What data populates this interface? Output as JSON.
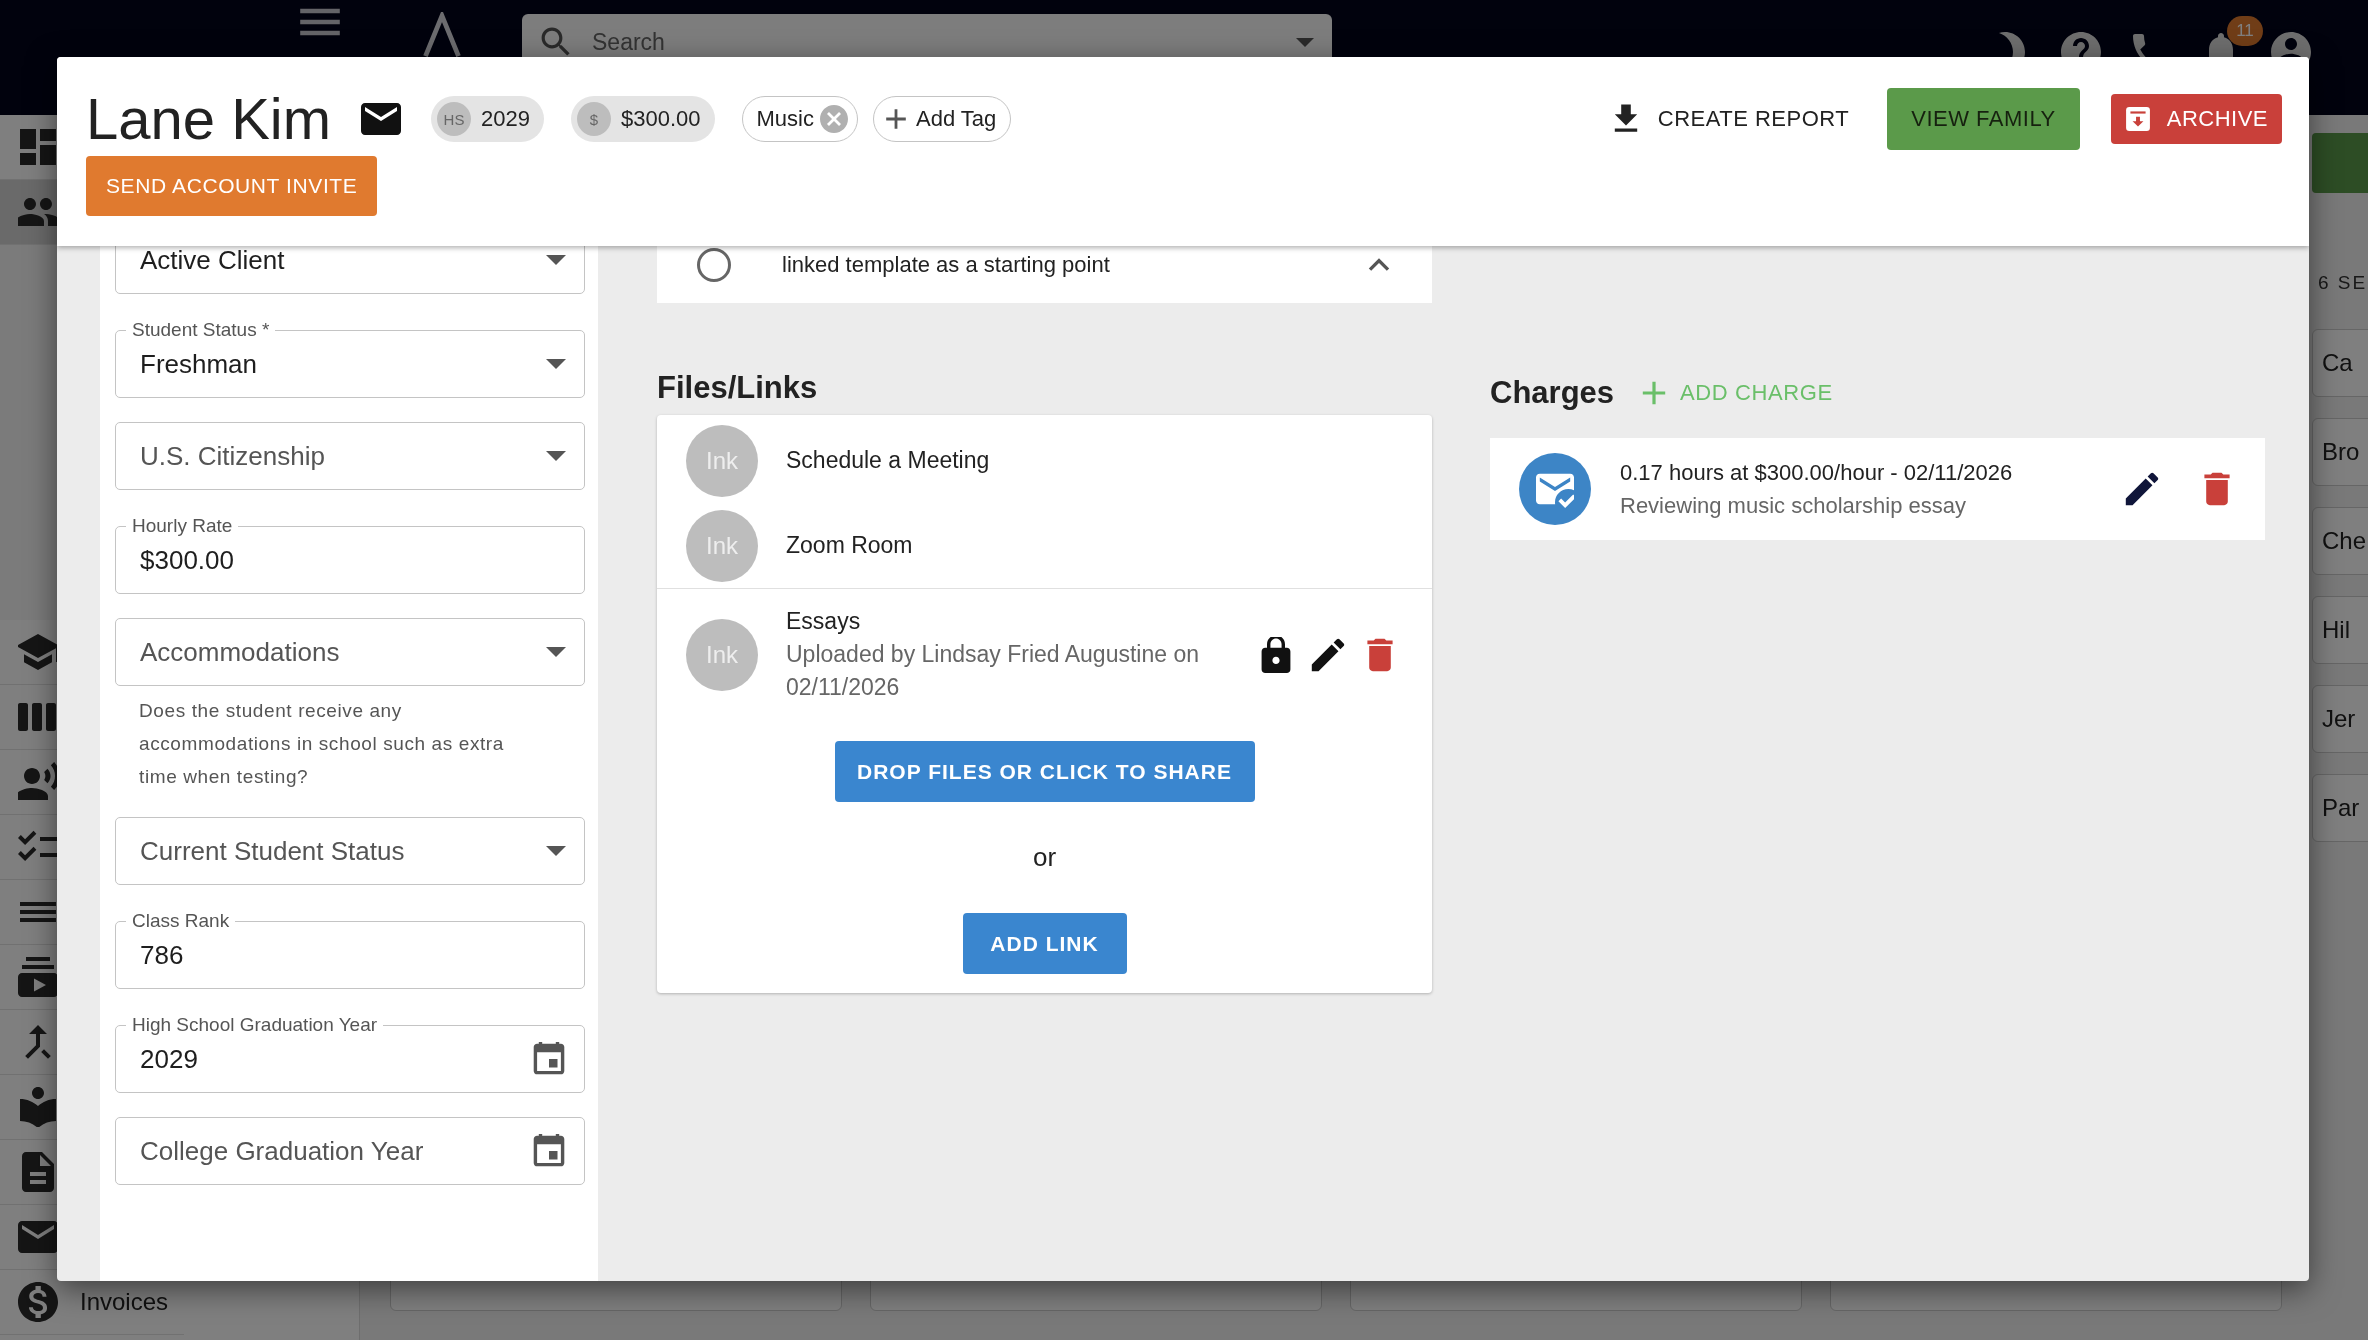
{
  "app": {
    "top_bar": {
      "search": {
        "placeholder": "Search"
      },
      "notification_count": "11"
    },
    "sidebar": {
      "top_items": [
        {
          "kind": "dashboard",
          "selected": false
        },
        {
          "kind": "people",
          "selected": true
        }
      ],
      "items": [
        {
          "kind": "school",
          "selected": false
        },
        {
          "kind": "columns",
          "selected": false
        },
        {
          "kind": "voice",
          "selected": false
        },
        {
          "kind": "checklist",
          "selected": false
        },
        {
          "kind": "list",
          "selected": false
        },
        {
          "kind": "video",
          "selected": false
        },
        {
          "kind": "merge",
          "selected": false
        },
        {
          "kind": "reader",
          "selected": false
        },
        {
          "kind": "document",
          "selected": false
        },
        {
          "kind": "mail",
          "selected": false
        },
        {
          "kind": "invoices",
          "label": "Invoices",
          "selected": false
        }
      ]
    },
    "side_list": {
      "header": "6 SE",
      "items": [
        "Ca",
        "Bro",
        "Che",
        "Hil",
        "Jer",
        "Par"
      ]
    }
  },
  "dialog": {
    "header": {
      "name": "Lane Kim",
      "chips": [
        {
          "kind": "avatar",
          "avatar": "HS",
          "label": "2029"
        },
        {
          "kind": "avatar",
          "avatar": "$",
          "label": "$300.00"
        }
      ],
      "tags": [
        {
          "kind": "removable",
          "label": "Music"
        },
        {
          "kind": "add",
          "label": "Add Tag"
        }
      ],
      "invite_button": "SEND ACCOUNT INVITE",
      "actions": [
        {
          "kind": "download",
          "label": "CREATE REPORT"
        },
        {
          "kind": "primary",
          "label": "VIEW FAMILY"
        },
        {
          "kind": "archive",
          "label": "ARCHIVE"
        }
      ]
    },
    "fields": [
      {
        "kind": "select",
        "value": "Active Client"
      },
      {
        "kind": "select",
        "label": "Student Status *",
        "value": "Freshman"
      },
      {
        "kind": "select",
        "label": "U.S. Citizenship"
      },
      {
        "kind": "text",
        "label": "Hourly Rate",
        "value": "$300.00"
      },
      {
        "kind": "select",
        "label": "Accommodations",
        "helper": "Does the student receive any accommodations in school such as extra time when testing?"
      },
      {
        "kind": "select",
        "label": "Current Student Status"
      },
      {
        "kind": "text",
        "label": "Class Rank",
        "value": "786"
      },
      {
        "kind": "date",
        "label": "High School Graduation Year",
        "value": "2029"
      },
      {
        "kind": "date",
        "label": "College Graduation Year"
      }
    ],
    "template_option": {
      "text": "linked template as a starting point",
      "selected": false
    },
    "files": {
      "title": "Files/Links",
      "links": [
        {
          "avatar": "Ink",
          "title": "Schedule a Meeting"
        },
        {
          "avatar": "Ink",
          "title": "Zoom Room"
        }
      ],
      "documents": [
        {
          "avatar": "Ink",
          "title": "Essays",
          "meta": "Uploaded by Lindsay Fried Augustine on 02/11/2026",
          "locked": true
        }
      ],
      "upload_label": "DROP FILES OR CLICK TO SHARE",
      "or_label": "or",
      "add_link_label": "ADD LINK"
    },
    "charges": {
      "title": "Charges",
      "add_label": "ADD CHARGE",
      "items": [
        {
          "title": "0.17 hours at $300.00/hour - 02/11/2026",
          "description": "Reviewing music scholarship essay"
        }
      ]
    }
  }
}
